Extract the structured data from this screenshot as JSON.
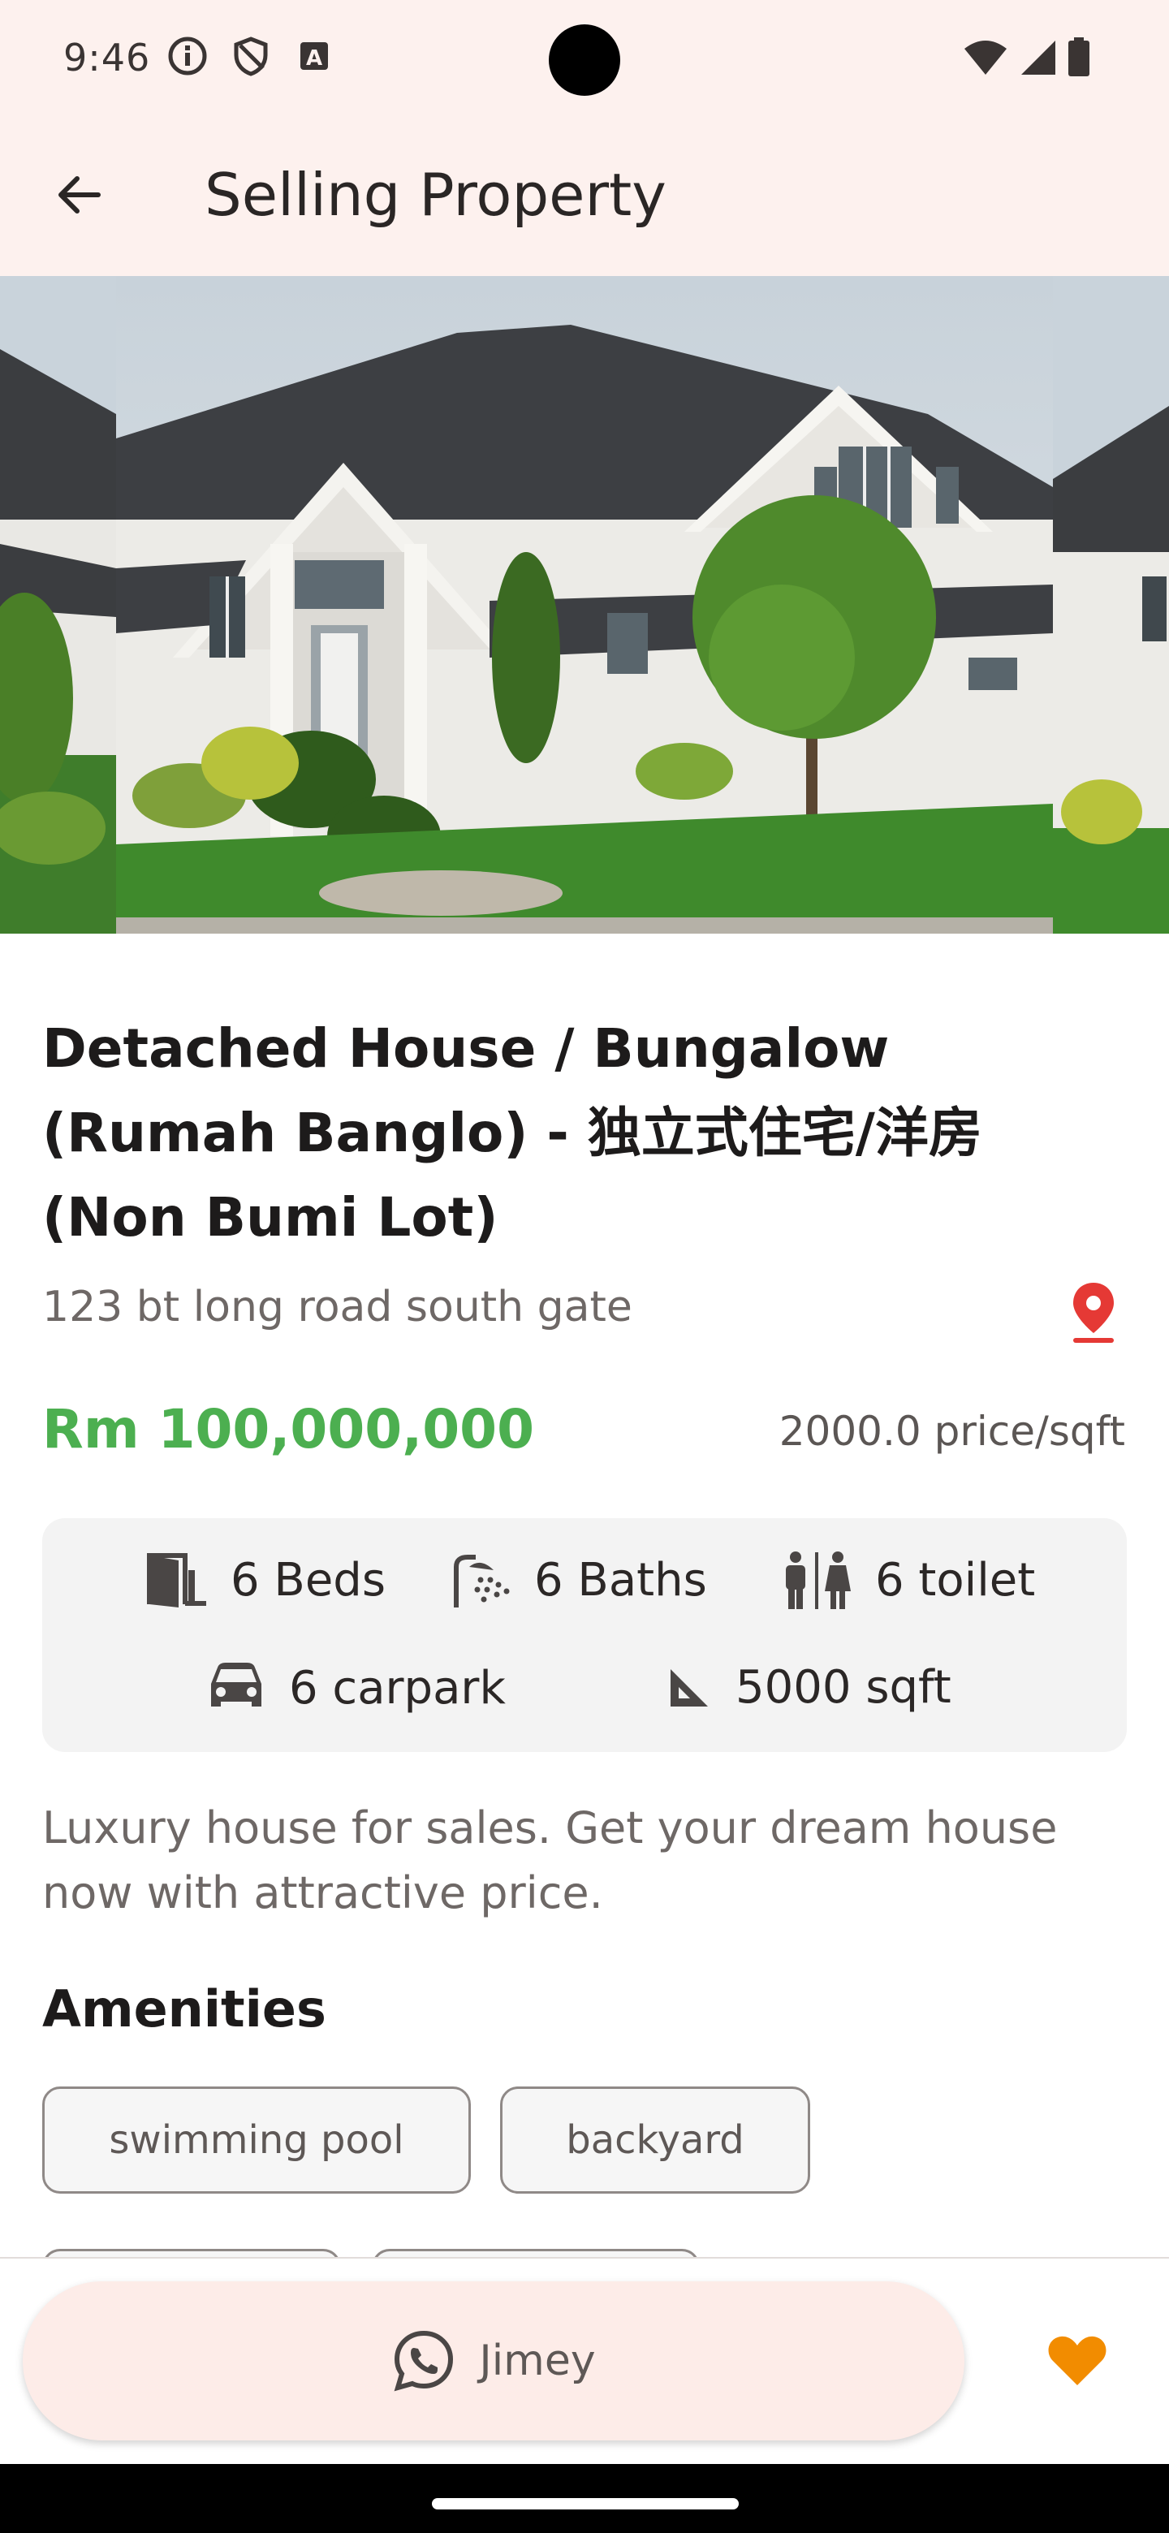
{
  "status_bar": {
    "time": "9:46",
    "icons": [
      "info-icon",
      "shield-icon",
      "text-a-icon",
      "wifi-icon",
      "signal-icon",
      "battery-icon"
    ]
  },
  "app_bar": {
    "back_icon": "arrow-left-icon",
    "title": "Selling Property"
  },
  "property": {
    "title": "Detached House / Bungalow (Rumah Banglo) - 独立式住宅/洋房 (Non Bumi Lot)",
    "address": "123 bt long road south gate",
    "price": "Rm 100,000,000",
    "price_per_sqft": "2000.0 price/sqft",
    "specs": {
      "beds": "6 Beds",
      "baths": "6 Baths",
      "toilet": "6 toilet",
      "carpark": "6 carpark",
      "area": "5000 sqft"
    },
    "description": "Luxury house for sales. Get your dream house now with attractive price."
  },
  "amenities": {
    "title": "Amenities",
    "items": [
      "swimming pool",
      "backyard"
    ]
  },
  "bottom": {
    "contact_name": "Jimey",
    "contact_icon": "whatsapp-icon",
    "favorite_icon": "heart-icon"
  },
  "colors": {
    "accent_green": "#4caf50",
    "pin_red": "#e53935",
    "heart_orange": "#f28c00",
    "surface": "#fdf1ee"
  }
}
